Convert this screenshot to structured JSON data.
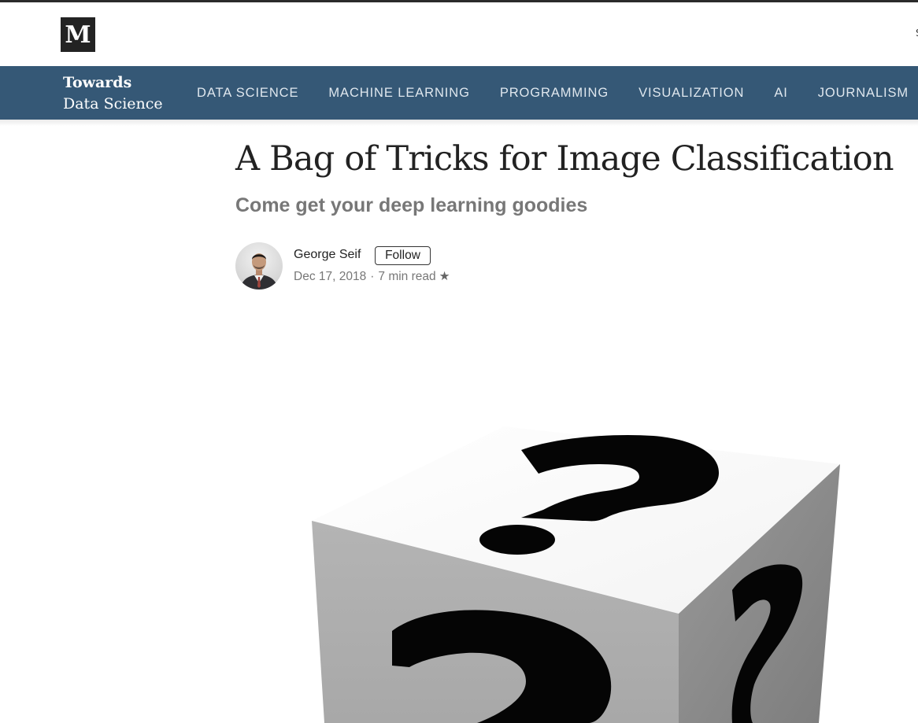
{
  "header": {
    "logo_letter": "M",
    "edge_glyph": "S"
  },
  "publication": {
    "name_line1": "Towards",
    "name_line2": "Data Science",
    "nav": [
      {
        "label": "DATA SCIENCE"
      },
      {
        "label": "MACHINE LEARNING"
      },
      {
        "label": "PROGRAMMING"
      },
      {
        "label": "VISUALIZATION"
      },
      {
        "label": "AI"
      },
      {
        "label": "JOURNALISM"
      }
    ],
    "bar_color": "#355876"
  },
  "article": {
    "title": "A Bag of Tricks for Image Classification",
    "subtitle": "Come get your deep learning goodies",
    "author": "George Seif",
    "follow_label": "Follow",
    "date": "Dec 17, 2018",
    "separator": "·",
    "read_time": "7 min read",
    "star": "★"
  },
  "hero": {
    "icon": "question-mark-cube"
  }
}
